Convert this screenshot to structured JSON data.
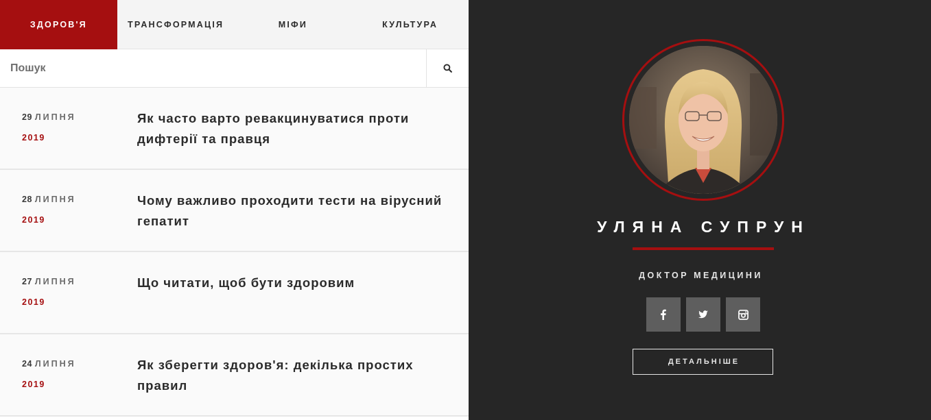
{
  "nav": {
    "tabs": [
      {
        "label": "ЗДОРОВ'Я",
        "active": true
      },
      {
        "label": "ТРАНСФОРМАЦІЯ",
        "active": false
      },
      {
        "label": "МІФИ",
        "active": false
      },
      {
        "label": "КУЛЬТУРА",
        "active": false
      }
    ]
  },
  "search": {
    "placeholder": "Пошук",
    "value": "",
    "icon": "search-icon"
  },
  "articles": [
    {
      "day": "29",
      "month": "ЛИПНЯ",
      "year": "2019",
      "title": "Як часто варто ревакцинуватися проти дифтерії та правця"
    },
    {
      "day": "28",
      "month": "ЛИПНЯ",
      "year": "2019",
      "title": "Чому важливо проходити тести на вірусний гепатит"
    },
    {
      "day": "27",
      "month": "ЛИПНЯ",
      "year": "2019",
      "title": "Що читати, щоб бути здоровим"
    },
    {
      "day": "24",
      "month": "ЛИПНЯ",
      "year": "2019",
      "title": "Як зберегти здоров'я: декілька простих правил"
    }
  ],
  "profile": {
    "name": "УЛЯНА СУПРУН",
    "role": "ДОКТОР МЕДИЦИНИ",
    "socials": [
      "facebook-icon",
      "twitter-icon",
      "instagram-icon"
    ],
    "more_label": "ДЕТАЛЬНІШЕ"
  },
  "colors": {
    "accent": "#a50f10",
    "panel_bg": "#262626",
    "social_bg": "#5e5e5e",
    "tabs_bg": "#f4f4f4"
  }
}
